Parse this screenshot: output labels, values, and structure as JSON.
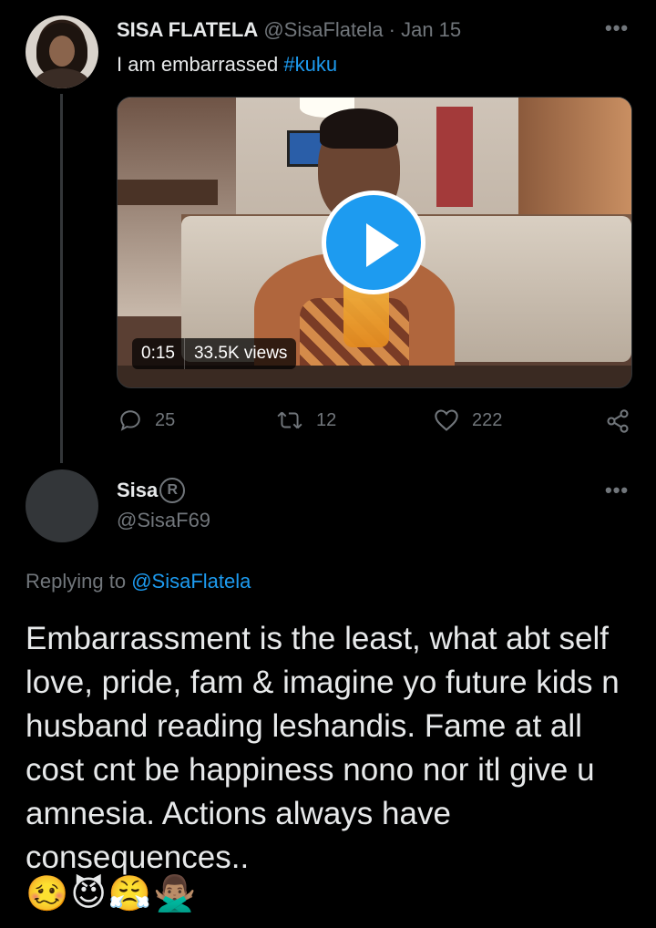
{
  "tweet": {
    "author_name": "SISA FLATELA",
    "author_handle": "@SisaFlatela",
    "separator": "·",
    "date": "Jan 15",
    "more_label": "•••",
    "text_plain": "I am embarrassed ",
    "hashtag": "#kuku",
    "video": {
      "duration": "0:15",
      "views": "33.5K views"
    },
    "actions": {
      "replies": "25",
      "retweets": "12",
      "likes": "222"
    }
  },
  "reply": {
    "author_name": "Sisa",
    "badge": "R",
    "author_handle": "@SisaF69",
    "more_label": "•••",
    "replying_prefix": "Replying to ",
    "replying_to": "@SisaFlatela",
    "text": "Embarrassment is the least, what abt self love, pride, fam & imagine yo future kids n husband reading leshandis. Fame at all cost cnt be happiness nono nor itl give u amnesia. Actions always have consequences..",
    "emojis": "🥴😈😤🙅🏽‍♂️"
  },
  "colors": {
    "background": "#000000",
    "text": "#e7e9ea",
    "muted": "#71767b",
    "accent": "#1d9bf0"
  },
  "icons": [
    "reply-icon",
    "retweet-icon",
    "like-icon",
    "share-icon",
    "play-icon",
    "more-icon"
  ]
}
